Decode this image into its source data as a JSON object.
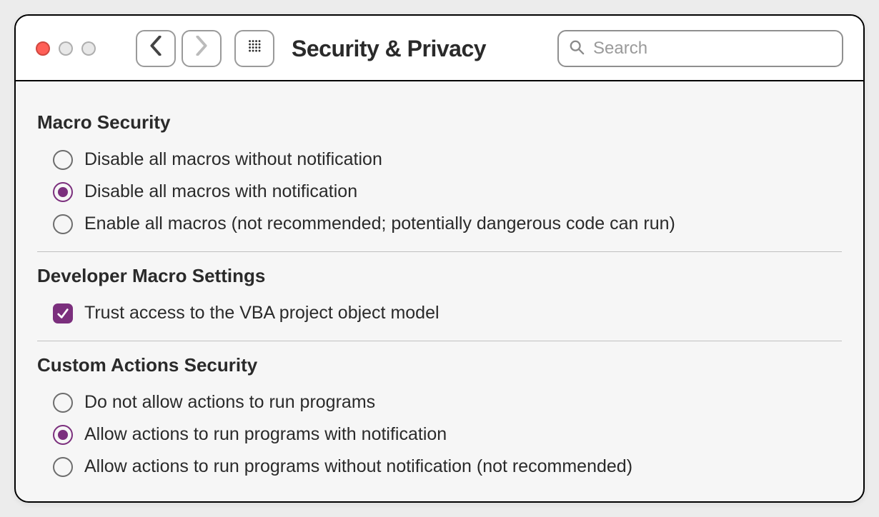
{
  "window": {
    "title": "Security & Privacy",
    "search_placeholder": "Search"
  },
  "sections": {
    "macro_security": {
      "heading": "Macro Security",
      "options": [
        "Disable all macros without notification",
        "Disable all macros with notification",
        "Enable all macros (not recommended; potentially dangerous code can run)"
      ],
      "selected_index": 1
    },
    "developer": {
      "heading": "Developer Macro Settings",
      "option": "Trust access to the VBA project object model",
      "checked": true
    },
    "custom_actions": {
      "heading": "Custom Actions Security",
      "options": [
        "Do not allow actions to run programs",
        "Allow actions to run programs with notification",
        "Allow actions to run programs without notification (not recommended)"
      ],
      "selected_index": 1
    }
  }
}
